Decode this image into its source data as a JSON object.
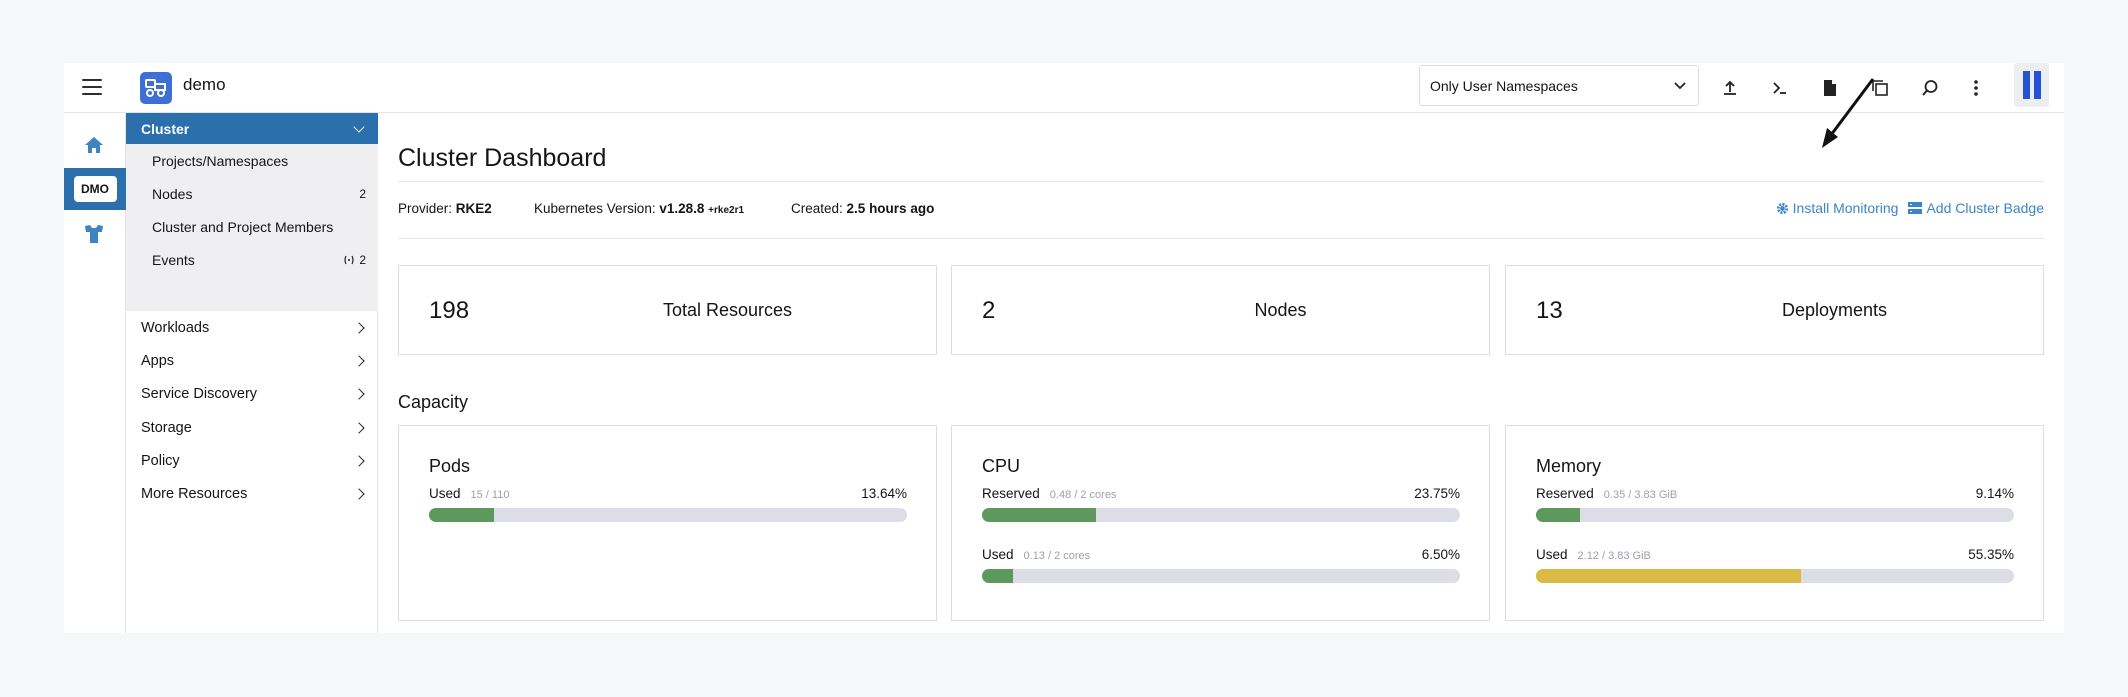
{
  "topbar": {
    "cluster_name": "demo",
    "namespace_filter": "Only User Namespaces"
  },
  "rail": {
    "active_cluster_badge": "DMO"
  },
  "nav": {
    "group_label": "Cluster",
    "sub_items": [
      {
        "label": "Projects/Namespaces",
        "count": ""
      },
      {
        "label": "Nodes",
        "count": "2"
      },
      {
        "label": "Cluster and Project Members",
        "count": ""
      },
      {
        "label": "Events",
        "count": "2"
      }
    ],
    "items": [
      {
        "label": "Workloads"
      },
      {
        "label": "Apps"
      },
      {
        "label": "Service Discovery"
      },
      {
        "label": "Storage"
      },
      {
        "label": "Policy"
      },
      {
        "label": "More Resources"
      }
    ]
  },
  "main": {
    "title": "Cluster Dashboard",
    "provider_label": "Provider:",
    "provider_value": "RKE2",
    "k8s_label": "Kubernetes Version:",
    "k8s_value": "v1.28.8",
    "k8s_suffix": "+rke2r1",
    "created_label": "Created:",
    "created_value": "2.5 hours ago",
    "install_monitoring": "Install Monitoring",
    "add_cluster_badge": "Add Cluster Badge",
    "tiles": [
      {
        "count": "198",
        "label": "Total Resources"
      },
      {
        "count": "2",
        "label": "Nodes"
      },
      {
        "count": "13",
        "label": "Deployments"
      }
    ],
    "capacity_title": "Capacity",
    "cards": [
      {
        "title": "Pods",
        "gauges": [
          {
            "label": "Used",
            "detail": "15 / 110",
            "percent_text": "13.64%",
            "fraction": 0.1364,
            "color": "#5d995d"
          }
        ]
      },
      {
        "title": "CPU",
        "gauges": [
          {
            "label": "Reserved",
            "detail": "0.48 / 2 cores",
            "percent_text": "23.75%",
            "fraction": 0.2375,
            "color": "#5d995d"
          },
          {
            "label": "Used",
            "detail": "0.13 / 2 cores",
            "percent_text": "6.50%",
            "fraction": 0.065,
            "color": "#5d995d"
          }
        ]
      },
      {
        "title": "Memory",
        "gauges": [
          {
            "label": "Reserved",
            "detail": "0.35 / 3.83 GiB",
            "percent_text": "9.14%",
            "fraction": 0.0914,
            "color": "#5d995d"
          },
          {
            "label": "Used",
            "detail": "2.12 / 3.83 GiB",
            "percent_text": "55.35%",
            "fraction": 0.5535,
            "color": "#daba45"
          }
        ]
      }
    ]
  },
  "colors": {
    "accent": "#2b6fad",
    "link": "#3d84c6",
    "ok": "#5d995d",
    "warning": "#daba45"
  }
}
